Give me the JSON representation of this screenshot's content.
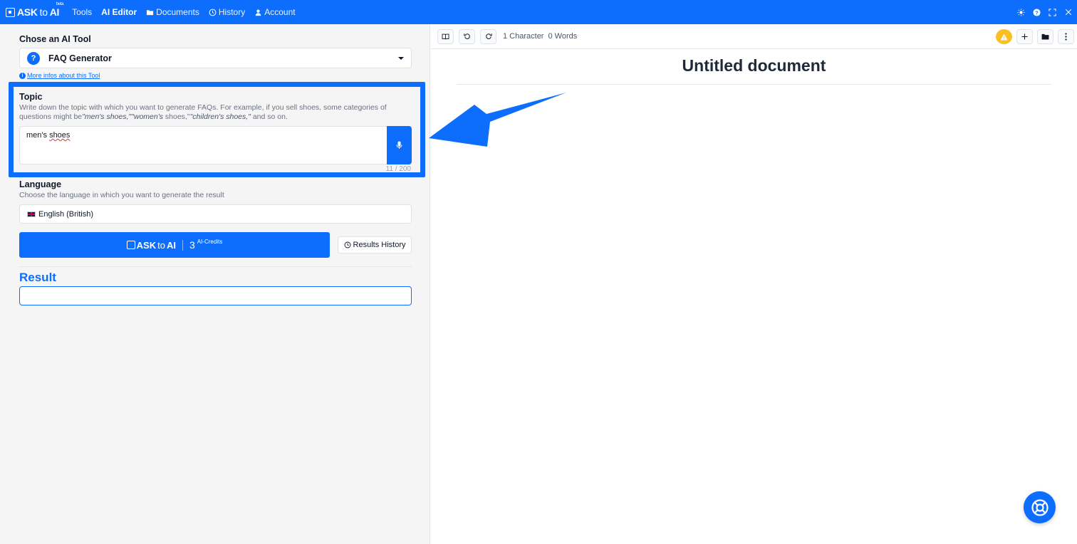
{
  "nav": {
    "logo_ask": "ASK",
    "logo_to": "to",
    "logo_ai": "AI",
    "logo_badge": "beta",
    "items": [
      {
        "label": "Tools"
      },
      {
        "label": "AI Editor"
      },
      {
        "label": "Documents"
      },
      {
        "label": "History"
      },
      {
        "label": "Account"
      }
    ]
  },
  "form": {
    "tool_label": "Chose an AI Tool",
    "tool_value": "FAQ Generator",
    "more_info": "More infos about this Tool",
    "topic_label": "Topic",
    "topic_desc_1": "Write down the topic with which you want to generate FAQs. For example, if you sell shoes, some categories of questions might be",
    "topic_example_1": "\"men's shoes,\"",
    "topic_example_2": "\"women's",
    "topic_mid": " shoes,\"",
    "topic_example_3": "\"children's shoes,\"",
    "topic_desc_end": " and so on.",
    "topic_value_a": "men's ",
    "topic_value_b": "shoes",
    "counter": "11 / 200",
    "language_label": "Language",
    "language_desc": "Choose the language in which you want to generate the result",
    "language_value": "English (British)",
    "credits_number": "3",
    "credits_label": "AI-Credits",
    "history_button": "Results History",
    "result_title": "Result"
  },
  "editor": {
    "characters": "1 Character",
    "words": "0 Words",
    "doc_title": "Untitled document"
  },
  "colors": {
    "primary": "#0d6efd",
    "warning": "#fbbf24"
  }
}
